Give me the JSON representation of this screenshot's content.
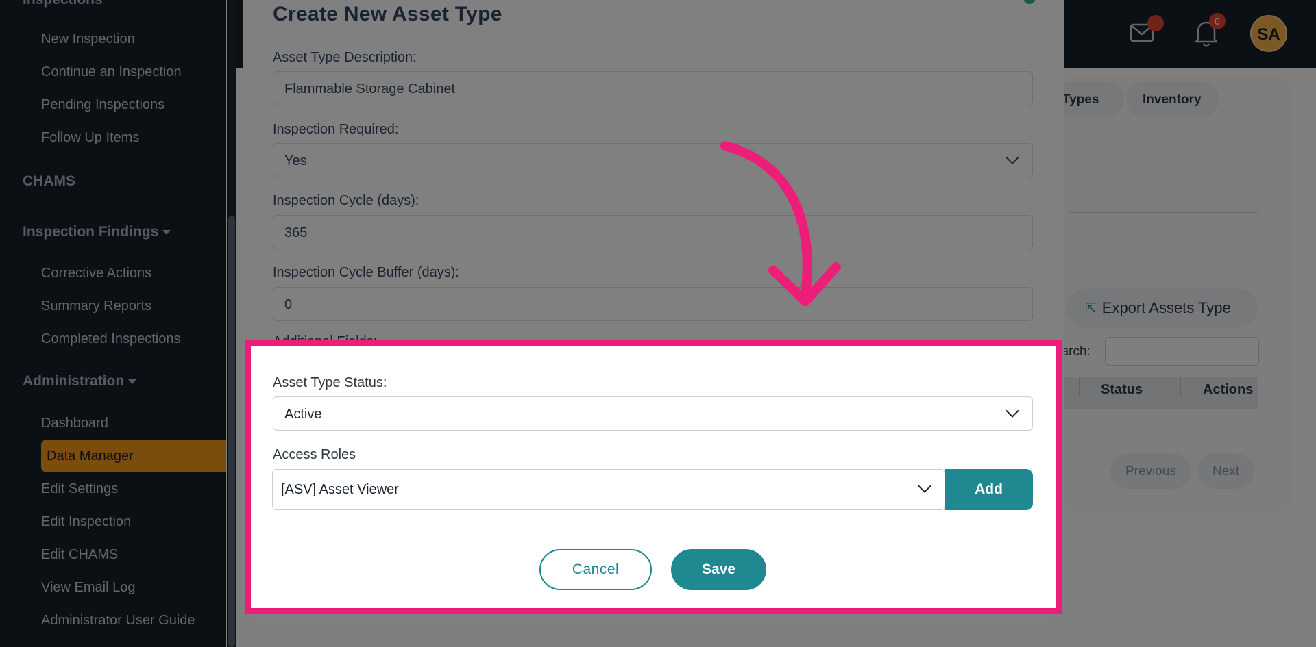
{
  "sidebar": {
    "partial_heading": "Inspections",
    "inspection_items": [
      "New Inspection",
      "Continue an Inspection",
      "Pending Inspections",
      "Follow Up Items"
    ],
    "chams": "CHAMS",
    "findings_heading": "Inspection Findings",
    "findings_items": [
      "Corrective Actions",
      "Summary Reports",
      "Completed Inspections"
    ],
    "admin_heading": "Administration",
    "admin_items": [
      "Dashboard",
      "Data Manager",
      "Edit Settings",
      "Edit Inspection",
      "Edit CHAMS",
      "View Email Log",
      "Administrator User Guide"
    ]
  },
  "header": {
    "mail_badge": "",
    "bell_badge": "0",
    "avatar_initials": "SA"
  },
  "background": {
    "tab_partial": "p Types",
    "tab_inventory": "Inventory",
    "export_label": "Export Assets Type",
    "search_label": "earch:",
    "col_status": "Status",
    "col_actions": "Actions",
    "previous": "Previous",
    "next": "Next"
  },
  "modal": {
    "title": "Create New Asset Type",
    "description_label": "Asset Type Description:",
    "description_value": "Flammable Storage Cabinet",
    "inspection_required_label": "Inspection Required:",
    "inspection_required_value": "Yes",
    "cycle_label": "Inspection Cycle (days):",
    "cycle_value": "365",
    "buffer_label": "Inspection Cycle Buffer (days):",
    "buffer_value": "0",
    "additional_fields_label": "Additional Fields:",
    "status_label": "Asset Type Status:",
    "status_value": "Active",
    "access_roles_label": "Access Roles",
    "access_roles_value": "[ASV] Asset Viewer",
    "add_label": "Add",
    "cancel_label": "Cancel",
    "save_label": "Save"
  },
  "colors": {
    "highlight": "#ed1e79",
    "accent": "#1f8890",
    "active_nav": "#f59b1a"
  }
}
